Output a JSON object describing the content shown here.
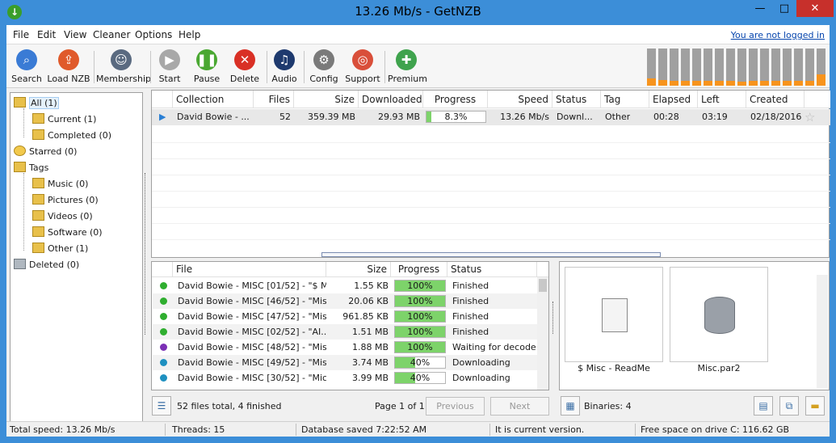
{
  "window": {
    "title": "13.26 Mb/s - GetNZB",
    "min": "—",
    "max": "□",
    "close": "✕"
  },
  "menu": [
    "File",
    "Edit",
    "View",
    "Cleaner",
    "Options",
    "Help"
  ],
  "login_link": "You are not logged in",
  "toolbar": [
    {
      "label": "Search",
      "icon": "search-icon",
      "color": "#3a7bd5"
    },
    {
      "label": "Load NZB",
      "icon": "load-nzb-icon",
      "color": "#e05a2b"
    },
    {
      "label": "Membership",
      "icon": "membership-icon",
      "color": "#5a6a80"
    },
    {
      "label": "Start",
      "icon": "play-icon",
      "color": "#a8a8a8"
    },
    {
      "label": "Pause",
      "icon": "pause-icon",
      "color": "#4aa832"
    },
    {
      "label": "Delete",
      "icon": "delete-icon",
      "color": "#d93025"
    },
    {
      "label": "Audio",
      "icon": "audio-icon",
      "color": "#1e3a6e"
    },
    {
      "label": "Config",
      "icon": "gear-icon",
      "color": "#7a7a7a"
    },
    {
      "label": "Support",
      "icon": "lifebuoy-icon",
      "color": "#d94f3a"
    },
    {
      "label": "Premium",
      "icon": "gift-icon",
      "color": "#3fa34d"
    }
  ],
  "speed_meter": {
    "levels": [
      0.2,
      0.15,
      0.12,
      0.12,
      0.12,
      0.12,
      0.12,
      0.12,
      0.1,
      0.12,
      0.12,
      0.12,
      0.12,
      0.12,
      0.12,
      0.3
    ],
    "accent": "#f7941d"
  },
  "tree": {
    "all": "All (1)",
    "current": "Current (1)",
    "completed": "Completed (0)",
    "starred": "Starred (0)",
    "tags": "Tags",
    "music": "Music (0)",
    "pictures": "Pictures (0)",
    "videos": "Videos (0)",
    "software": "Software (0)",
    "other": "Other (1)",
    "deleted": "Deleted (0)"
  },
  "downloads": {
    "headers": [
      "Collection",
      "Files",
      "Size",
      "Downloaded",
      "Progress",
      "Speed",
      "Status",
      "Tag",
      "Elapsed",
      "Left",
      "Created"
    ],
    "row": {
      "collection": "David Bowie - ...",
      "files": "52",
      "size": "359.39 MB",
      "downloaded": "29.93 MB",
      "progress": "8.3%",
      "progress_value": 0.083,
      "speed": "13.26 Mb/s",
      "status": "Downl...",
      "tag": "Other",
      "elapsed": "00:28",
      "left": "03:19",
      "created": "02/18/2016"
    }
  },
  "files": {
    "headers": [
      "File",
      "Size",
      "Progress",
      "Status"
    ],
    "rows": [
      {
        "name": "David Bowie - MISC [01/52] - \"$ M...",
        "size": "1.55 KB",
        "progress": "100%",
        "value": 1.0,
        "status": "Finished",
        "dot": "#2fae2f"
      },
      {
        "name": "David Bowie - MISC [46/52] - \"Mis...",
        "size": "20.06 KB",
        "progress": "100%",
        "value": 1.0,
        "status": "Finished",
        "dot": "#2fae2f"
      },
      {
        "name": "David Bowie - MISC [47/52] - \"Mis...",
        "size": "961.85 KB",
        "progress": "100%",
        "value": 1.0,
        "status": "Finished",
        "dot": "#2fae2f"
      },
      {
        "name": "David Bowie - MISC [02/52] - \"AI...",
        "size": "1.51 MB",
        "progress": "100%",
        "value": 1.0,
        "status": "Finished",
        "dot": "#2fae2f"
      },
      {
        "name": "David Bowie - MISC [48/52] - \"Mis...",
        "size": "1.88 MB",
        "progress": "100%",
        "value": 1.0,
        "status": "Waiting for decode",
        "dot": "#7b2fb5"
      },
      {
        "name": "David Bowie - MISC [49/52] - \"Mis...",
        "size": "3.74 MB",
        "progress": "40%",
        "value": 0.4,
        "status": "Downloading",
        "dot": "#1e90c0"
      },
      {
        "name": "David Bowie - MISC [30/52] - \"Mic...",
        "size": "3.99 MB",
        "progress": "40%",
        "value": 0.4,
        "status": "Downloading",
        "dot": "#1e90c0"
      }
    ]
  },
  "preview": [
    {
      "label": "$ Misc - ReadMe",
      "icon": "document-icon"
    },
    {
      "label": "Misc.par2",
      "icon": "database-icon"
    }
  ],
  "bottom": {
    "files_summary": "52 files total, 4 finished",
    "page": "Page 1 of 1",
    "previous": "Previous",
    "next": "Next",
    "binaries": "Binaries: 4"
  },
  "status": {
    "total_speed": "Total speed: 13.26 Mb/s",
    "threads": "Threads: 15",
    "db": "Database saved 7:22:52 AM",
    "version": "It is current version.",
    "free": "Free space on drive C: 116.62 GB"
  }
}
